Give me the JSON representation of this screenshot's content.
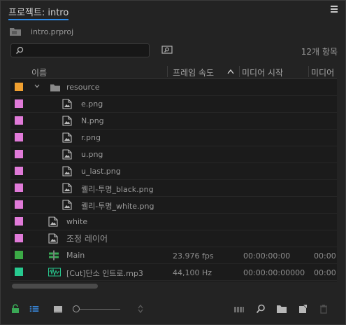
{
  "panel": {
    "title": "프로젝트: intro",
    "project_file": "intro.prproj",
    "search": {
      "value": "",
      "placeholder": ""
    },
    "item_count": "12개 항목"
  },
  "columns": {
    "name": "이름",
    "framerate": "프레임 속도",
    "media_start": "미디어 시작",
    "media_end": "미디어"
  },
  "rows": [
    {
      "name": "resource",
      "type": "folder",
      "swatch": "#f0a030",
      "framerate": "",
      "media_start": "",
      "media_end": ""
    },
    {
      "name": "e.png",
      "type": "image",
      "swatch": "#e07ad8",
      "framerate": "",
      "media_start": "",
      "media_end": ""
    },
    {
      "name": "N.png",
      "type": "image",
      "swatch": "#e07ad8",
      "framerate": "",
      "media_start": "",
      "media_end": ""
    },
    {
      "name": "r.png",
      "type": "image",
      "swatch": "#e07ad8",
      "framerate": "",
      "media_start": "",
      "media_end": ""
    },
    {
      "name": "u.png",
      "type": "image",
      "swatch": "#e07ad8",
      "framerate": "",
      "media_start": "",
      "media_end": ""
    },
    {
      "name": "u_last.png",
      "type": "image",
      "swatch": "#e07ad8",
      "framerate": "",
      "media_start": "",
      "media_end": ""
    },
    {
      "name": "퀠리-투명_black.png",
      "type": "image",
      "swatch": "#e07ad8",
      "framerate": "",
      "media_start": "",
      "media_end": ""
    },
    {
      "name": "퀠리-투명_white.png",
      "type": "image",
      "swatch": "#e07ad8",
      "framerate": "",
      "media_start": "",
      "media_end": ""
    },
    {
      "name": "white",
      "type": "image",
      "swatch": "#e07ad8",
      "framerate": "",
      "media_start": "",
      "media_end": ""
    },
    {
      "name": "조정 레이어",
      "type": "image",
      "swatch": "#e07ad8",
      "framerate": "",
      "media_start": "",
      "media_end": ""
    },
    {
      "name": "Main",
      "type": "sequence",
      "swatch": "#3caa46",
      "framerate": "23.976 fps",
      "media_start": "00:00:00:00",
      "media_end": "00:00"
    },
    {
      "name": "[Cut]단소 인트로.mp3",
      "type": "audio",
      "swatch": "#27c98f",
      "framerate": "44,100 Hz",
      "media_start": "00:00:00:00000",
      "media_end": "00:00"
    }
  ],
  "colors": {
    "accent": "#2d8ceb",
    "lock": "#3aa856"
  },
  "icons": [
    "lock-icon",
    "list-view-icon",
    "icon-view-icon",
    "zoom-slider",
    "sort-icon",
    "automate-icon",
    "find-icon",
    "new-bin-icon",
    "new-item-icon",
    "trash-icon"
  ]
}
